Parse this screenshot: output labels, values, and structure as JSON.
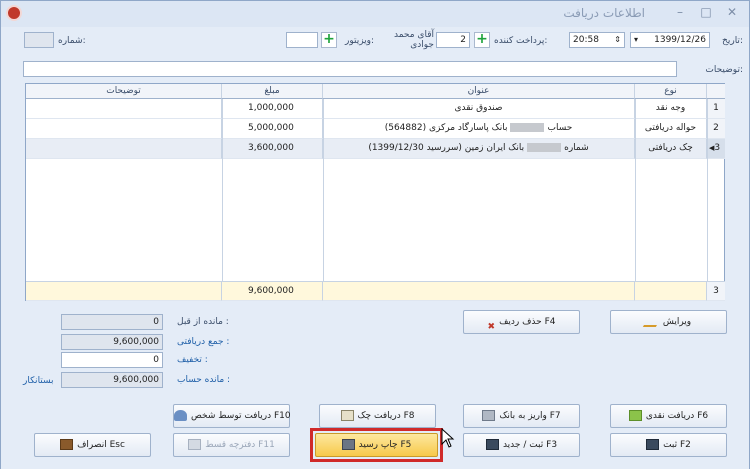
{
  "window": {
    "title": "اطلاعات دریافت",
    "minimize": "–",
    "maximize": "□",
    "close": "✕"
  },
  "form": {
    "date_label": "تاریخ:",
    "date": "1399/12/26",
    "time": "20:58",
    "payer_label": "پرداخت کننده:",
    "payer_code": "2",
    "payer_name": "آقای محمد\nجوادی",
    "visitor_label": "ویزیتور:",
    "visitor": "",
    "number_label": "شماره:",
    "number": "",
    "description_label": "توضیحات:",
    "description": ""
  },
  "grid": {
    "headers": {
      "type": "نوع",
      "title": "عنوان",
      "amount": "مبلغ",
      "notes": "توضیحات"
    },
    "rows": [
      {
        "num": "1",
        "type": "وجه نقد",
        "title": "صندوق نقدی",
        "amount": "1,000,000",
        "notes": ""
      },
      {
        "num": "2",
        "type": "حواله دریافتی",
        "title_pre": "حساب",
        "title_post": "بانک پاسارگاد مرکزی (564882)",
        "amount": "5,000,000",
        "notes": ""
      },
      {
        "num": "3",
        "type": "چک دریافتی",
        "title_pre": "شماره",
        "title_post": "بانک ایران زمین (سررسید 1399/12/30)",
        "amount": "3,600,000",
        "notes": ""
      }
    ],
    "footer": {
      "count": "3",
      "total": "9,600,000"
    }
  },
  "summary": {
    "prev_balance_label": "مانده از قبل :",
    "prev_balance": "0",
    "total_received_label": "جمع دریافتی :",
    "total_received": "9,600,000",
    "discount_label": "تخفیف :",
    "discount": "0",
    "account_balance_label": "مانده حساب :",
    "account_balance": "9,600,000",
    "balance_status": "بستانکار"
  },
  "buttons": {
    "edit": "ویرایش",
    "delete_row": "حذف ردیف F4",
    "cash": "دریافت نقدی F6",
    "bank": "واریز به بانک F7",
    "check": "دریافت چک F8",
    "person": "دریافت توسط شخص F10",
    "save": "ثبت F2",
    "save_new": "ثبت / جدید F3",
    "print": "چاپ رسید F5",
    "installment": "دفترچه قسط F11",
    "cancel": "انصراف Esc"
  },
  "colors": {
    "highlight": "#d02a2a",
    "print_button": "#f7c94a"
  }
}
